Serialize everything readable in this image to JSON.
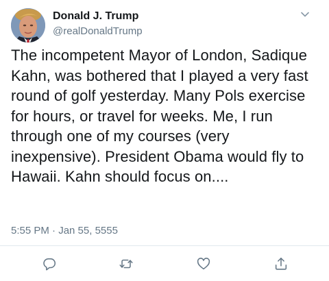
{
  "user": {
    "display_name": "Donald J. Trump",
    "handle": "@realDonaldTrump"
  },
  "tweet": {
    "text": "The incompetent Mayor of London, Sadique Kahn, was bothered that I played a very fast round of golf yesterday. Many Pols exercise for hours, or travel for weeks. Me, I run through one of my courses (very inexpensive). President Obama would fly to Hawaii. Kahn should focus on....",
    "timestamp": "5:55 PM · Jan 55, 5555"
  },
  "icons": {
    "menu": "chevron-down-icon",
    "reply": "reply-icon",
    "retweet": "retweet-icon",
    "like": "heart-icon",
    "share": "share-icon"
  },
  "colors": {
    "primary_text": "#14171a",
    "secondary_text": "#657786",
    "divider": "#e1e8ed"
  }
}
